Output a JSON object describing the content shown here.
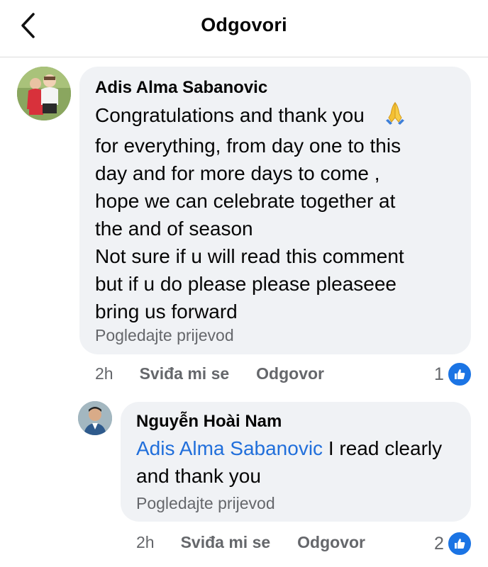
{
  "header": {
    "title": "Odgovori",
    "back_icon": "chevron-left-icon"
  },
  "comment": {
    "author": "Adis Alma Sabanovic",
    "text": "Congratulations and thank you",
    "emoji": "folded-hands-icon",
    "text_rest": "for everything, from day one to this\nday and for more days to come ,\nhope we can celebrate together at\nthe and of season\nNot sure if u will read this comment\nbut if u do please please pleaseee\nbring us forward",
    "translate": "Pogledajte prijevod",
    "time": "2h",
    "like_label": "Sviđa mi se",
    "reply_label": "Odgovor",
    "reaction_count": "1"
  },
  "reply": {
    "author": "Nguyễn Hoài Nam",
    "mention": "Adis Alma Sabanovic",
    "text": " I read clearly and thank you",
    "translate": "Pogledajte prijevod",
    "time": "2h",
    "like_label": "Sviđa mi se",
    "reply_label": "Odgovor",
    "reaction_count": "2"
  },
  "colors": {
    "mention": "#216fdb",
    "like_badge": "#1b74e4",
    "bubble": "#f0f2f5",
    "meta": "#65676b"
  }
}
